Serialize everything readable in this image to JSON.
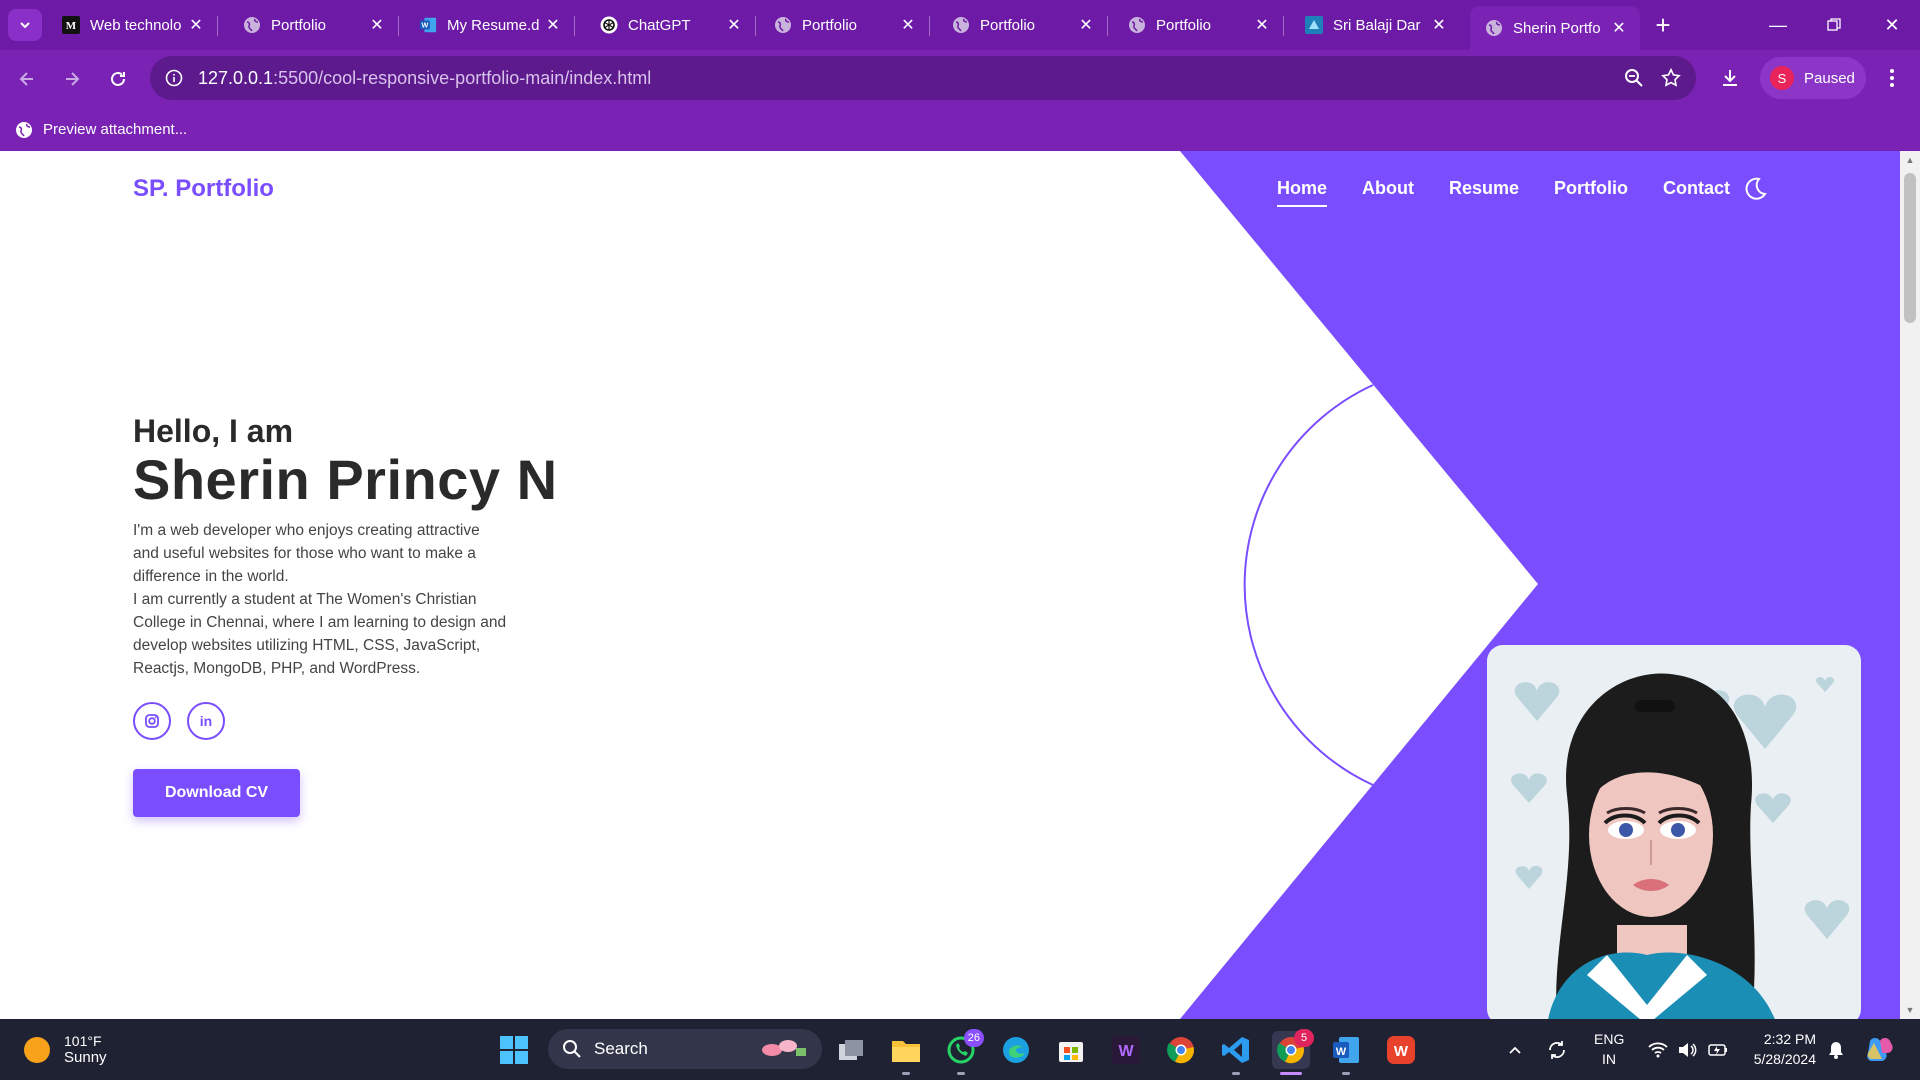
{
  "browser": {
    "tabs": [
      {
        "title": "Web technolo",
        "icon": "medium-icon"
      },
      {
        "title": "Portfolio",
        "icon": "globe-icon"
      },
      {
        "title": "My Resume.d",
        "icon": "word-icon"
      },
      {
        "title": "ChatGPT",
        "icon": "chatgpt-icon"
      },
      {
        "title": "Portfolio",
        "icon": "globe-icon"
      },
      {
        "title": "Portfolio",
        "icon": "globe-icon"
      },
      {
        "title": "Portfolio",
        "icon": "globe-icon"
      },
      {
        "title": "Sri Balaji Dar",
        "icon": "site-icon"
      },
      {
        "title": "Sherin Portfo",
        "icon": "globe-icon",
        "active": true
      }
    ],
    "url_host": "127.0.0.1",
    "url_path": ":5500/cool-responsive-portfolio-main/index.html",
    "profile_initial": "S",
    "profile_status": "Paused",
    "bookmark_label": "Preview attachment...",
    "theme_color": "#7a22b4"
  },
  "page": {
    "logo": "SP. Portfolio",
    "nav": [
      "Home",
      "About",
      "Resume",
      "Portfolio",
      "Contact"
    ],
    "active_nav": "Home",
    "greeting": "Hello, I am",
    "name": "Sherin Princy N",
    "description_lines": [
      "I'm a web developer who enjoys creating attractive",
      "and useful websites for those who want to make a",
      "difference in the world.",
      "I am currently a student at The Women's Christian",
      "College in Chennai, where I am learning to design and",
      "develop websites utilizing HTML, CSS, JavaScript,",
      "Reactjs, MongoDB, PHP, and WordPress."
    ],
    "socials": [
      {
        "icon": "instagram-icon",
        "glyph": "◘"
      },
      {
        "icon": "linkedin-icon",
        "glyph": "in"
      }
    ],
    "cta": "Download CV",
    "accent": "#7a4dff"
  },
  "taskbar": {
    "weather_temp": "101°F",
    "weather_cond": "Sunny",
    "search_placeholder": "Search",
    "whatsapp_badge": "26",
    "chrome_badge": "5",
    "lang_top": "ENG",
    "lang_bottom": "IN",
    "time": "2:32 PM",
    "date": "5/28/2024"
  }
}
